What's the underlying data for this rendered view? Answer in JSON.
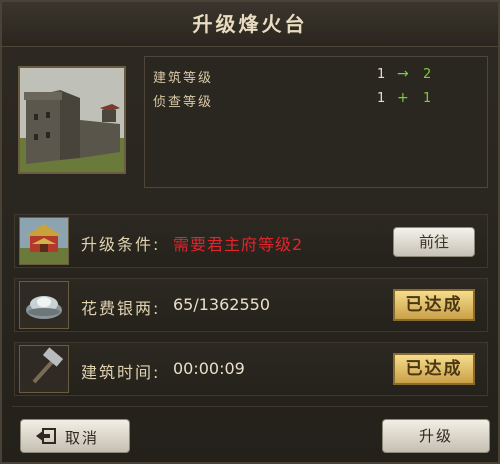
{
  "dialog": {
    "title": "升级烽火台"
  },
  "stats": [
    {
      "label": "建筑等级",
      "from": "1",
      "op": "→",
      "to": "2"
    },
    {
      "label": "侦查等级",
      "from": "1",
      "op": "+",
      "to": "1"
    }
  ],
  "requirements": [
    {
      "label": "升级条件:",
      "value": "需要君主府等级2",
      "button": "前往",
      "icon": "palace-icon"
    },
    {
      "label": "花费银两:",
      "value": "65/1362550",
      "badge": "已达成",
      "icon": "silver-ingot-icon"
    },
    {
      "label": "建筑时间:",
      "value": "00:00:09",
      "badge": "已达成",
      "icon": "hammer-icon"
    }
  ],
  "footer": {
    "cancel_label": "取消",
    "upgrade_label": "升级"
  },
  "colors": {
    "accent_green": "#7ecb3f",
    "requirement_red": "#e3242b",
    "badge_gold": "#caa048"
  }
}
